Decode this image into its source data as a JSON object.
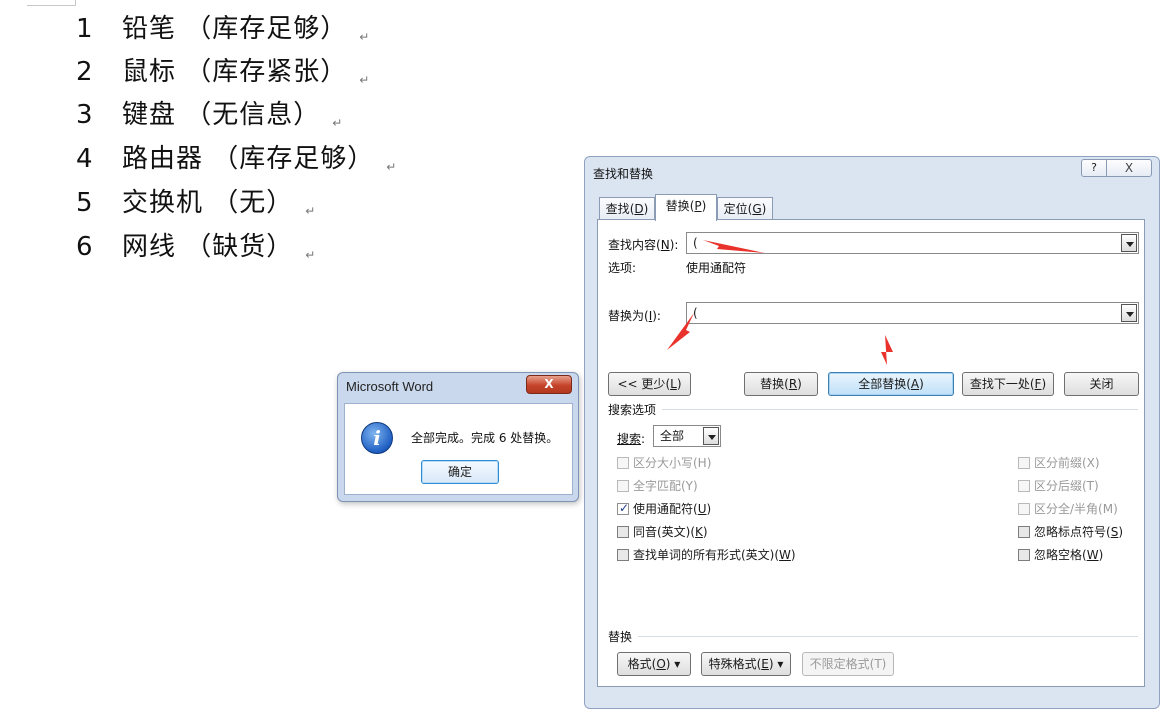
{
  "document": {
    "lines": [
      {
        "num": "1",
        "text": "铅笔 （库存足够）"
      },
      {
        "num": "2",
        "text": "鼠标 （库存紧张）"
      },
      {
        "num": "3",
        "text": "键盘 （无信息）"
      },
      {
        "num": "4",
        "text": "路由器 （库存足够）"
      },
      {
        "num": "5",
        "text": "交换机 （无）"
      },
      {
        "num": "6",
        "text": "网线 （缺货）"
      }
    ],
    "paragraph_mark": "↵"
  },
  "message_dialog": {
    "title": "Microsoft Word",
    "close_label": "X",
    "message": "全部完成。完成 6 处替换。",
    "ok_label": "确定"
  },
  "find_replace": {
    "title": "查找和替换",
    "help_label": "?",
    "close_label": "X",
    "tabs": [
      {
        "label": "查找",
        "key": "D"
      },
      {
        "label": "替换",
        "key": "P"
      },
      {
        "label": "定位",
        "key": "G"
      }
    ],
    "find_label": "查找内容",
    "find_key": "N",
    "find_value": "(",
    "options_label": "选项:",
    "options_value": "使用通配符",
    "replace_label": "替换为",
    "replace_key": "I",
    "replace_value": "(",
    "buttons": {
      "less": {
        "label": "<< 更少",
        "key": "L"
      },
      "replace": {
        "label": "替换",
        "key": "R"
      },
      "replace_all": {
        "label": "全部替换",
        "key": "A"
      },
      "find_next": {
        "label": "查找下一处",
        "key": "F"
      },
      "close": "关闭"
    },
    "search_options_title": "搜索选项",
    "search_label": "搜索",
    "search_value": "全部",
    "left_options": [
      {
        "label": "区分大小写(H)",
        "state": "disabled"
      },
      {
        "label": "全字匹配(Y)",
        "state": "disabled"
      },
      {
        "label": "使用通配符(",
        "key": "U",
        "tail": ")",
        "state": "checked"
      },
      {
        "label": "同音(英文)(",
        "key": "K",
        "tail": ")",
        "state": "unchecked"
      },
      {
        "label": "查找单词的所有形式(英文)(",
        "key": "W",
        "tail": ")",
        "state": "unchecked"
      }
    ],
    "right_options": [
      {
        "label": "区分前缀(X)",
        "state": "disabled"
      },
      {
        "label": "区分后缀(T)",
        "state": "disabled"
      },
      {
        "label": "区分全/半角(M)",
        "state": "disabled"
      },
      {
        "label": "忽略标点符号(",
        "key": "S",
        "tail": ")",
        "state": "unchecked"
      },
      {
        "label": "忽略空格(",
        "key": "W",
        "tail": ")",
        "state": "unchecked"
      }
    ],
    "replace_section_title": "替换",
    "format_button": {
      "label": "格式(",
      "key": "O",
      "tail": ") ▾"
    },
    "special_button": {
      "label": "特殊格式(",
      "key": "E",
      "tail": ") ▾"
    },
    "no_format_button": "不限定格式(T)"
  },
  "colors": {
    "annotation_arrow": "#e8322b",
    "dialog_bg": "#dbe5f2"
  }
}
